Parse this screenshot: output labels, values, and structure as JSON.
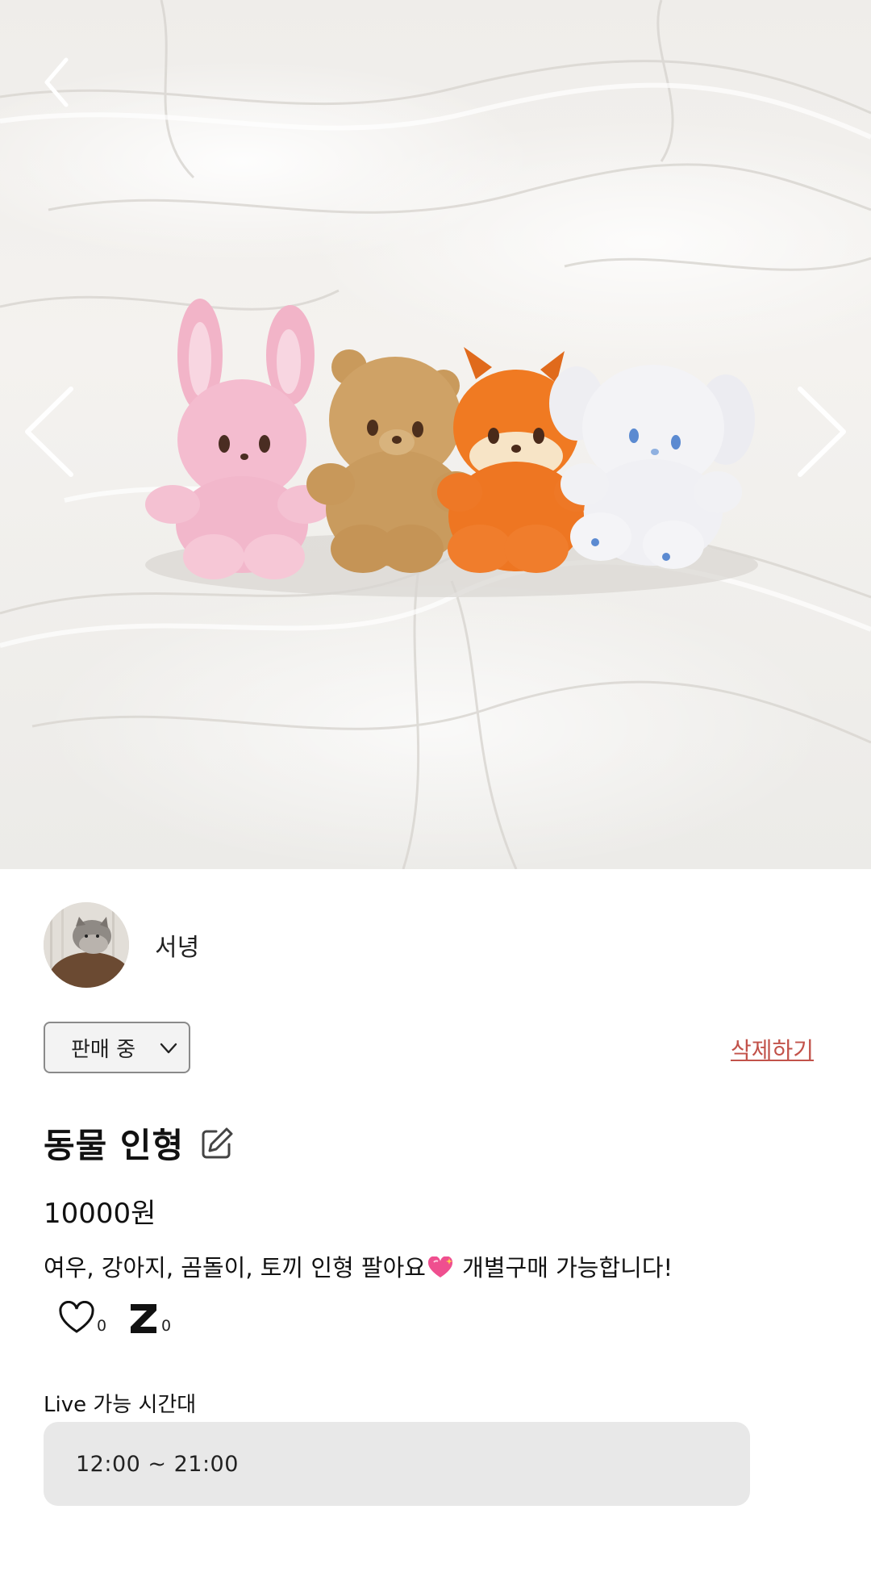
{
  "nav": {
    "back_icon": "chevron-left-icon",
    "prev_icon": "chevron-left-icon",
    "next_icon": "chevron-right-icon"
  },
  "seller": {
    "name": "서녕"
  },
  "status": {
    "selected": "판매 중",
    "dropdown_icon": "chevron-down-icon"
  },
  "actions": {
    "delete_label": "삭제하기",
    "delete_color": "#c2524a"
  },
  "product": {
    "title": "동물 인형",
    "edit_icon": "pencil-icon",
    "price": "10000원",
    "description_before": "여우, 강아지, 곰돌이, 토끼 인형 팔아요",
    "description_emoji": "sparkling-heart-icon",
    "description_after": " 개별구매 가능합니다!"
  },
  "stats": {
    "likes_icon": "heart-icon",
    "likes": "0",
    "z_icon": "z-icon",
    "z_count": "0"
  },
  "live": {
    "label": "Live 가능 시간대",
    "time": "12:00 ~ 21:00"
  }
}
